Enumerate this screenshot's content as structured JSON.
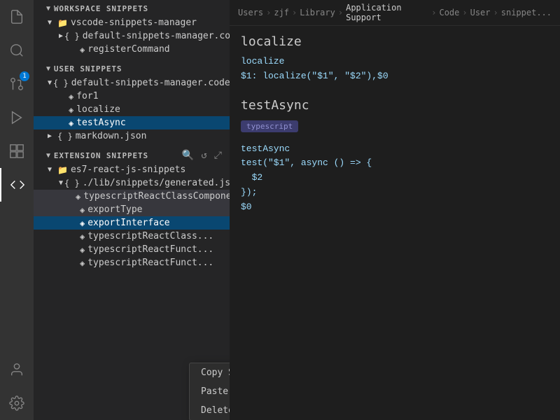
{
  "activityBar": {
    "icons": [
      {
        "name": "files-icon",
        "symbol": "⎘",
        "active": false
      },
      {
        "name": "search-icon",
        "symbol": "🔍",
        "active": false
      },
      {
        "name": "source-control-icon",
        "symbol": "⎇",
        "badge": "1",
        "active": false
      },
      {
        "name": "run-icon",
        "symbol": "▶",
        "active": false
      },
      {
        "name": "extensions-icon",
        "symbol": "⊞",
        "active": false
      },
      {
        "name": "snippets-icon",
        "symbol": "❮❯",
        "active": true
      }
    ],
    "bottomIcons": [
      {
        "name": "account-icon",
        "symbol": "👤"
      },
      {
        "name": "settings-icon",
        "symbol": "⚙"
      }
    ]
  },
  "explorer": {
    "workspaceSection": {
      "label": "WORKSPACE SNIPPETS",
      "items": [
        {
          "label": "vscode-snippets-manager",
          "level": 1,
          "type": "folder",
          "expanded": true
        },
        {
          "label": "default-snippets-manager.code-snippets",
          "level": 2,
          "type": "file-snippet",
          "expanded": false
        },
        {
          "label": "registerCommand",
          "level": 3,
          "type": "snippet"
        }
      ]
    },
    "userSection": {
      "label": "USER SNIPPETS",
      "items": [
        {
          "label": "default-snippets-manager.code-snippets",
          "level": 1,
          "type": "file-snippet",
          "expanded": true
        },
        {
          "label": "for1",
          "level": 2,
          "type": "snippet"
        },
        {
          "label": "localize",
          "level": 2,
          "type": "snippet"
        },
        {
          "label": "testAsync",
          "level": 2,
          "type": "snippet",
          "selected": true
        },
        {
          "label": "markdown.json",
          "level": 1,
          "type": "file",
          "collapsed": true
        }
      ]
    },
    "extensionSection": {
      "label": "EXTENSION SNIPPETS",
      "toolbarIcons": [
        "search",
        "refresh",
        "expand"
      ],
      "items": [
        {
          "label": "es7-react-js-snippets",
          "level": 1,
          "type": "folder",
          "expanded": true
        },
        {
          "label": "./lib/snippets/generated.json",
          "level": 2,
          "type": "file-snippet",
          "expanded": true
        },
        {
          "label": "typescriptReactClassComponent",
          "level": 3,
          "type": "snippet",
          "highlighted": true
        },
        {
          "label": "exportType",
          "level": 3,
          "type": "snippet",
          "highlighted": true
        },
        {
          "label": "exportInterface",
          "level": 3,
          "type": "snippet",
          "selected": true
        },
        {
          "label": "typescriptReactClass",
          "level": 3,
          "type": "snippet",
          "truncated": true
        },
        {
          "label": "typescriptReactFunct",
          "level": 3,
          "type": "snippet",
          "truncated": true
        },
        {
          "label": "typescriptReactFunct",
          "level": 3,
          "type": "snippet",
          "truncated": true
        }
      ]
    }
  },
  "breadcrumb": {
    "parts": [
      "Users",
      "zjf",
      "Library",
      "Application Support",
      "Code",
      "User",
      "snippet..."
    ]
  },
  "snippetPanel": {
    "snippet1": {
      "name": "localize",
      "body": "localize\n$1: localize(\"$1\", \"$2\"),$0"
    },
    "snippet2": {
      "name": "testAsync",
      "tag": "typescript",
      "body": "testAsync\ntest(\"$1\", async () => {\n  $2\n});\n$0"
    }
  },
  "contextMenu": {
    "items": [
      {
        "label": "Copy Snippet(s)",
        "name": "copy-snippets-item"
      },
      {
        "label": "Paste Snippet(s)",
        "name": "paste-snippets-item"
      },
      {
        "label": "Delete Snippet(s)",
        "name": "delete-snippets-item"
      }
    ]
  }
}
